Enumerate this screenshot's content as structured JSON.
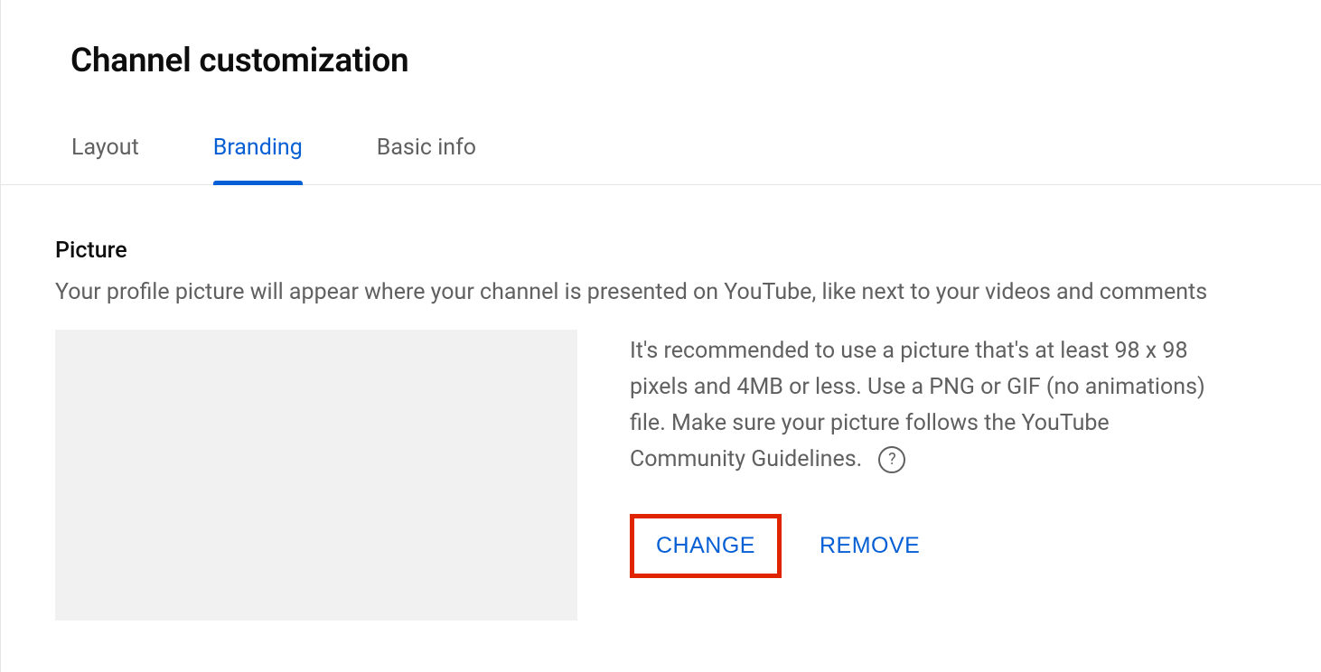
{
  "page": {
    "title": "Channel customization"
  },
  "tabs": {
    "layout": "Layout",
    "branding": "Branding",
    "basic_info": "Basic info"
  },
  "picture": {
    "title": "Picture",
    "description": "Your profile picture will appear where your channel is presented on YouTube, like next to your videos and comments",
    "recommendation": "It's recommended to use a picture that's at least 98 x 98 pixels and 4MB or less. Use a PNG or GIF (no animations) file. Make sure your picture follows the YouTube Community Guidelines.",
    "help_glyph": "?",
    "actions": {
      "change": "CHANGE",
      "remove": "REMOVE"
    }
  }
}
